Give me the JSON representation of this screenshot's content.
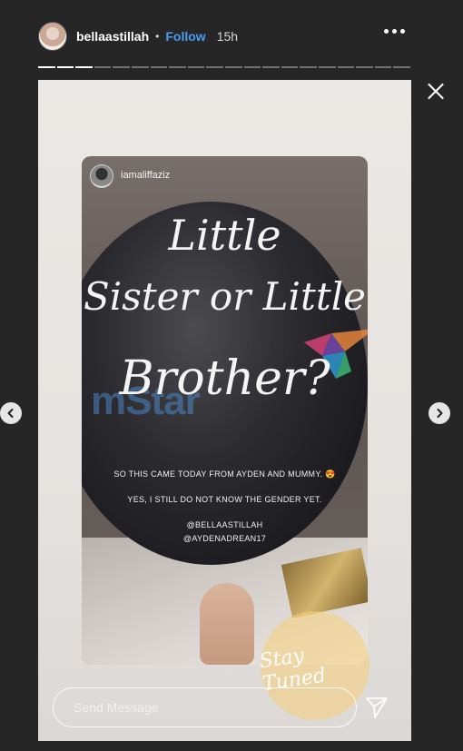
{
  "header": {
    "username": "bellaastillah",
    "separator": "•",
    "follow_label": "Follow",
    "timestamp": "15h"
  },
  "progress": {
    "segments": 20,
    "completed": 3
  },
  "story": {
    "repost_username": "iamaliffaziz",
    "script_line1": "Little",
    "script_line2": "Sister or Little",
    "script_line3": "Brother?",
    "caption_line1": "SO THIS CAME TODAY FROM AYDEN AND MUMMY. 😍",
    "caption_line2": "YES, I STILL DO NOT KNOW THE GENDER YET.",
    "mention1": "@BELLAASTILLAH",
    "mention2": "@AYDENADREAN17",
    "watermark": "mStar",
    "sticker_text": "Stay Tuned"
  },
  "reply": {
    "placeholder": "Send Message"
  },
  "icons": {
    "more": "more-options-icon",
    "close": "close-icon",
    "prev": "chevron-left-icon",
    "next": "chevron-right-icon",
    "send": "send-icon"
  }
}
